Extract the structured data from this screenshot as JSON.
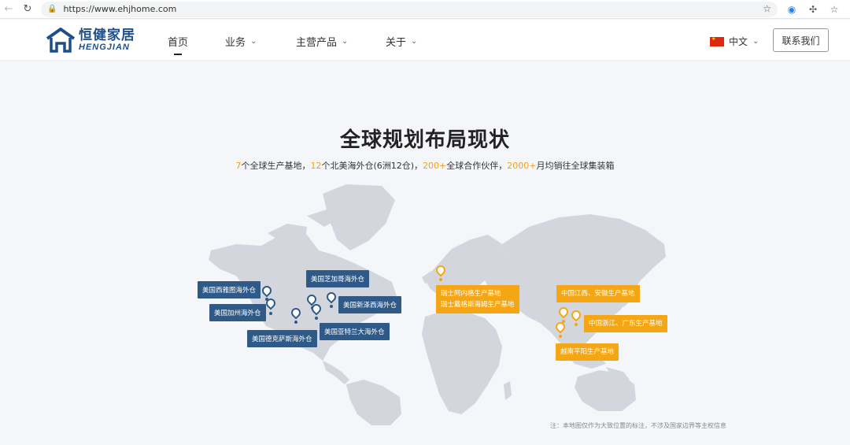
{
  "browser": {
    "url": "https://www.ehjhome.com"
  },
  "header": {
    "logo_cn": "恒健家居",
    "logo_en": "HENGJIAN",
    "nav": [
      {
        "label": "首页",
        "active": true
      },
      {
        "label": "业务",
        "has_dropdown": true
      },
      {
        "label": "主营产品",
        "has_dropdown": true
      },
      {
        "label": "关于",
        "has_dropdown": true
      }
    ],
    "language": "中文",
    "contact_label": "联系我们"
  },
  "main": {
    "title": "全球规划布局现状",
    "subtitle": {
      "n1": "7",
      "t1": "个全球生产基地，",
      "n2": "12",
      "t2": "个北美海外仓(6洲12仓)，",
      "n3": "200+",
      "t3": "全球合作伙伴，",
      "n4": "2000+",
      "t4": "月均销往全球集装箱"
    },
    "map_labels": {
      "seattle": "美国西雅图海外仓",
      "california": "美国加州海外仓",
      "texas": "美国德克萨斯海外仓",
      "chicago": "美国芝加哥海外仓",
      "newjersey": "美国新泽西海外仓",
      "atlanta": "美国亚特兰大海外仓",
      "swiss_line1": "瑞士阿内格生产基地",
      "swiss_line2": "瑞士戴格斯海姆生产基地",
      "jiangxi": "中国江西、安徽生产基地",
      "zhejiang": "中国浙江、广东生产基地",
      "vietnam": "越南平阳生产基地"
    },
    "note": "注：本地图仅作为大致位置的标注，不涉及国家边界等主权信息"
  },
  "colors": {
    "brand": "#1f4f8a",
    "label_blue": "#2f5a87",
    "label_orange": "#f5a614",
    "highlight": "#f0a020",
    "map_land": "#d3d7dd"
  }
}
